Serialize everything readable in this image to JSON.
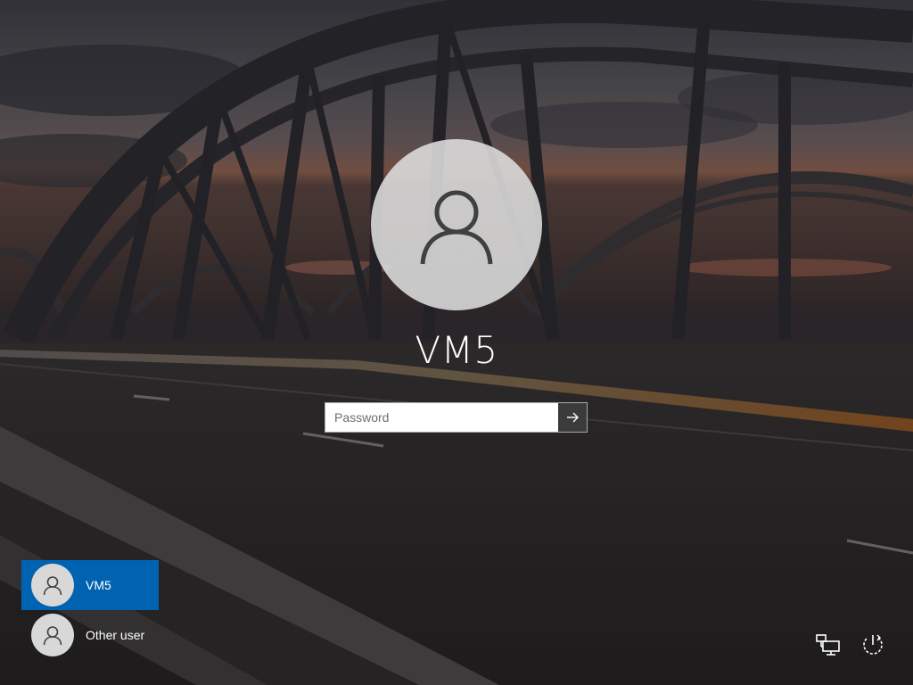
{
  "login": {
    "user_name": "VM5",
    "password_placeholder": "Password",
    "submit_icon": "arrow-right-icon"
  },
  "user_list": [
    {
      "label": "VM5",
      "selected": true,
      "icon": "user-avatar-icon"
    },
    {
      "label": "Other user",
      "selected": false,
      "icon": "user-avatar-icon"
    }
  ],
  "system_icons": [
    {
      "name": "network-icon"
    },
    {
      "name": "power-icon"
    }
  ],
  "colors": {
    "selected_user_bg": "#0063b1",
    "submit_button_bg": "#3b3b3b",
    "avatar_circle": "#dedede"
  }
}
